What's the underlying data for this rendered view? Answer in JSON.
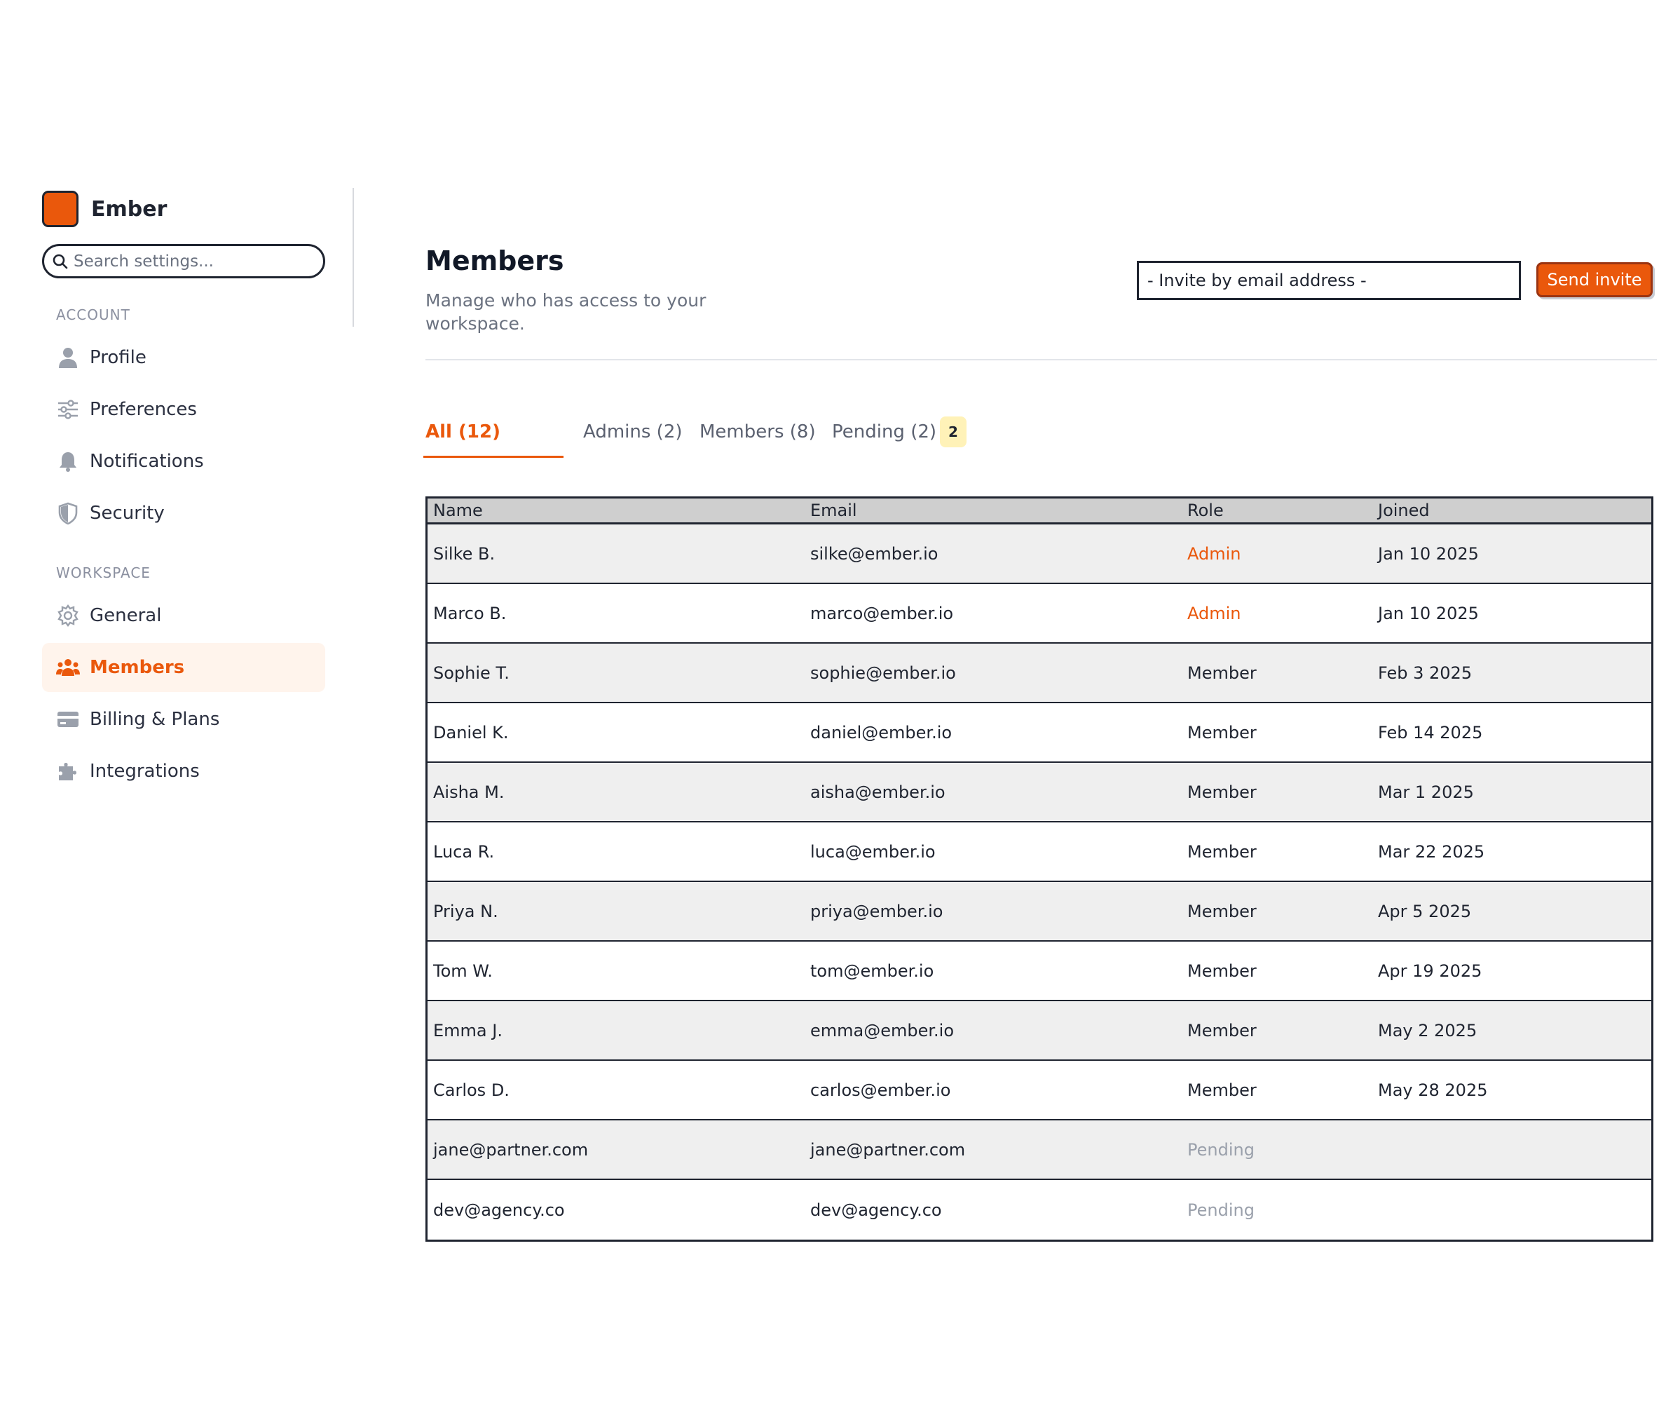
{
  "colors": {
    "accent": "#ea580c",
    "accent_bg": "#fff4ec",
    "badge_bg": "#fff2b8",
    "text": "#1f2430",
    "muted": "#6b7280",
    "pending": "#9aa0ab"
  },
  "app": {
    "name": "Ember"
  },
  "sidebar": {
    "search_placeholder": "Search settings...",
    "sections": [
      {
        "label": "ACCOUNT",
        "items": [
          {
            "label": "Profile",
            "icon": "user-icon"
          },
          {
            "label": "Preferences",
            "icon": "sliders-icon"
          },
          {
            "label": "Notifications",
            "icon": "bell-icon"
          },
          {
            "label": "Security",
            "icon": "shield-icon"
          }
        ]
      },
      {
        "label": "WORKSPACE",
        "items": [
          {
            "label": "General",
            "icon": "gear-icon"
          },
          {
            "label": "Members",
            "icon": "users-icon",
            "active": true
          },
          {
            "label": "Billing & Plans",
            "icon": "credit-card-icon"
          },
          {
            "label": "Integrations",
            "icon": "puzzle-icon"
          }
        ]
      }
    ]
  },
  "main": {
    "title": "Members",
    "subtitle": "Manage who has access to your workspace.",
    "invite_placeholder": "- Invite by email address -",
    "send_label": "Send invite",
    "tabs": [
      {
        "label": "All (12)",
        "active": true
      },
      {
        "label": "Admins (2)"
      },
      {
        "label": "Members (8)"
      },
      {
        "label": "Pending (2)",
        "badge": "2"
      }
    ],
    "table": {
      "columns": [
        "Name",
        "Email",
        "Role",
        "Joined"
      ],
      "rows": [
        {
          "name": "Silke B.",
          "email": "silke@ember.io",
          "role": "Admin",
          "joined": "Jan 10 2025"
        },
        {
          "name": "Marco B.",
          "email": "marco@ember.io",
          "role": "Admin",
          "joined": "Jan 10 2025"
        },
        {
          "name": "Sophie T.",
          "email": "sophie@ember.io",
          "role": "Member",
          "joined": "Feb 3 2025"
        },
        {
          "name": "Daniel K.",
          "email": "daniel@ember.io",
          "role": "Member",
          "joined": "Feb 14 2025"
        },
        {
          "name": "Aisha M.",
          "email": "aisha@ember.io",
          "role": "Member",
          "joined": "Mar 1 2025"
        },
        {
          "name": "Luca R.",
          "email": "luca@ember.io",
          "role": "Member",
          "joined": "Mar 22 2025"
        },
        {
          "name": "Priya N.",
          "email": "priya@ember.io",
          "role": "Member",
          "joined": "Apr 5 2025"
        },
        {
          "name": "Tom W.",
          "email": "tom@ember.io",
          "role": "Member",
          "joined": "Apr 19 2025"
        },
        {
          "name": "Emma J.",
          "email": "emma@ember.io",
          "role": "Member",
          "joined": "May 2 2025"
        },
        {
          "name": "Carlos D.",
          "email": "carlos@ember.io",
          "role": "Member",
          "joined": "May 28 2025"
        },
        {
          "name": "jane@partner.com",
          "email": "jane@partner.com",
          "role": "Pending",
          "joined": ""
        },
        {
          "name": "dev@agency.co",
          "email": "dev@agency.co",
          "role": "Pending",
          "joined": ""
        }
      ]
    }
  }
}
